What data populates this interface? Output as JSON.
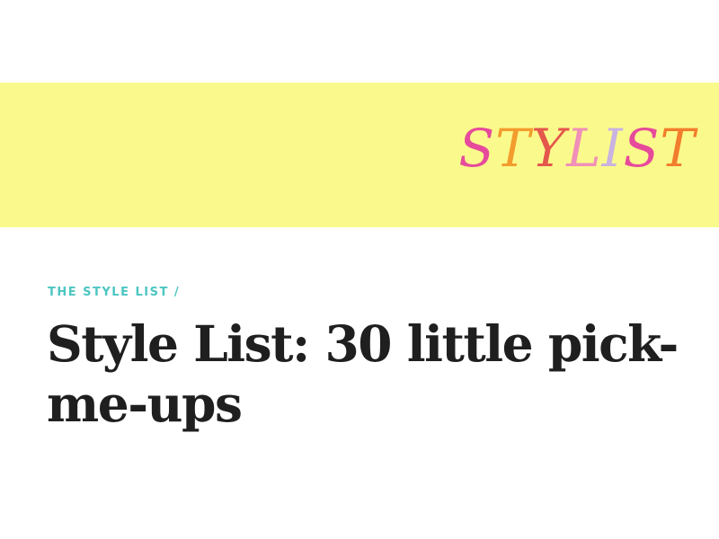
{
  "banner": {
    "background": "#fafa8c"
  },
  "logo": {
    "text": "STYLIST",
    "letters": [
      {
        "char": "S",
        "color": "#e64a9b"
      },
      {
        "char": "T",
        "color": "#f39c2e"
      },
      {
        "char": "Y",
        "color": "#e4574b"
      },
      {
        "char": "L",
        "color": "#f08fb8"
      },
      {
        "char": "I",
        "color": "#c9b3e0"
      },
      {
        "char": "S",
        "color": "#e64a9b"
      },
      {
        "char": "T",
        "color": "#f27d2d"
      }
    ]
  },
  "breadcrumb": {
    "section": "THE STYLE LIST",
    "separator": "/",
    "color": "#4cc6c2"
  },
  "article": {
    "title": "Style List: 30 little pick-me-ups"
  }
}
